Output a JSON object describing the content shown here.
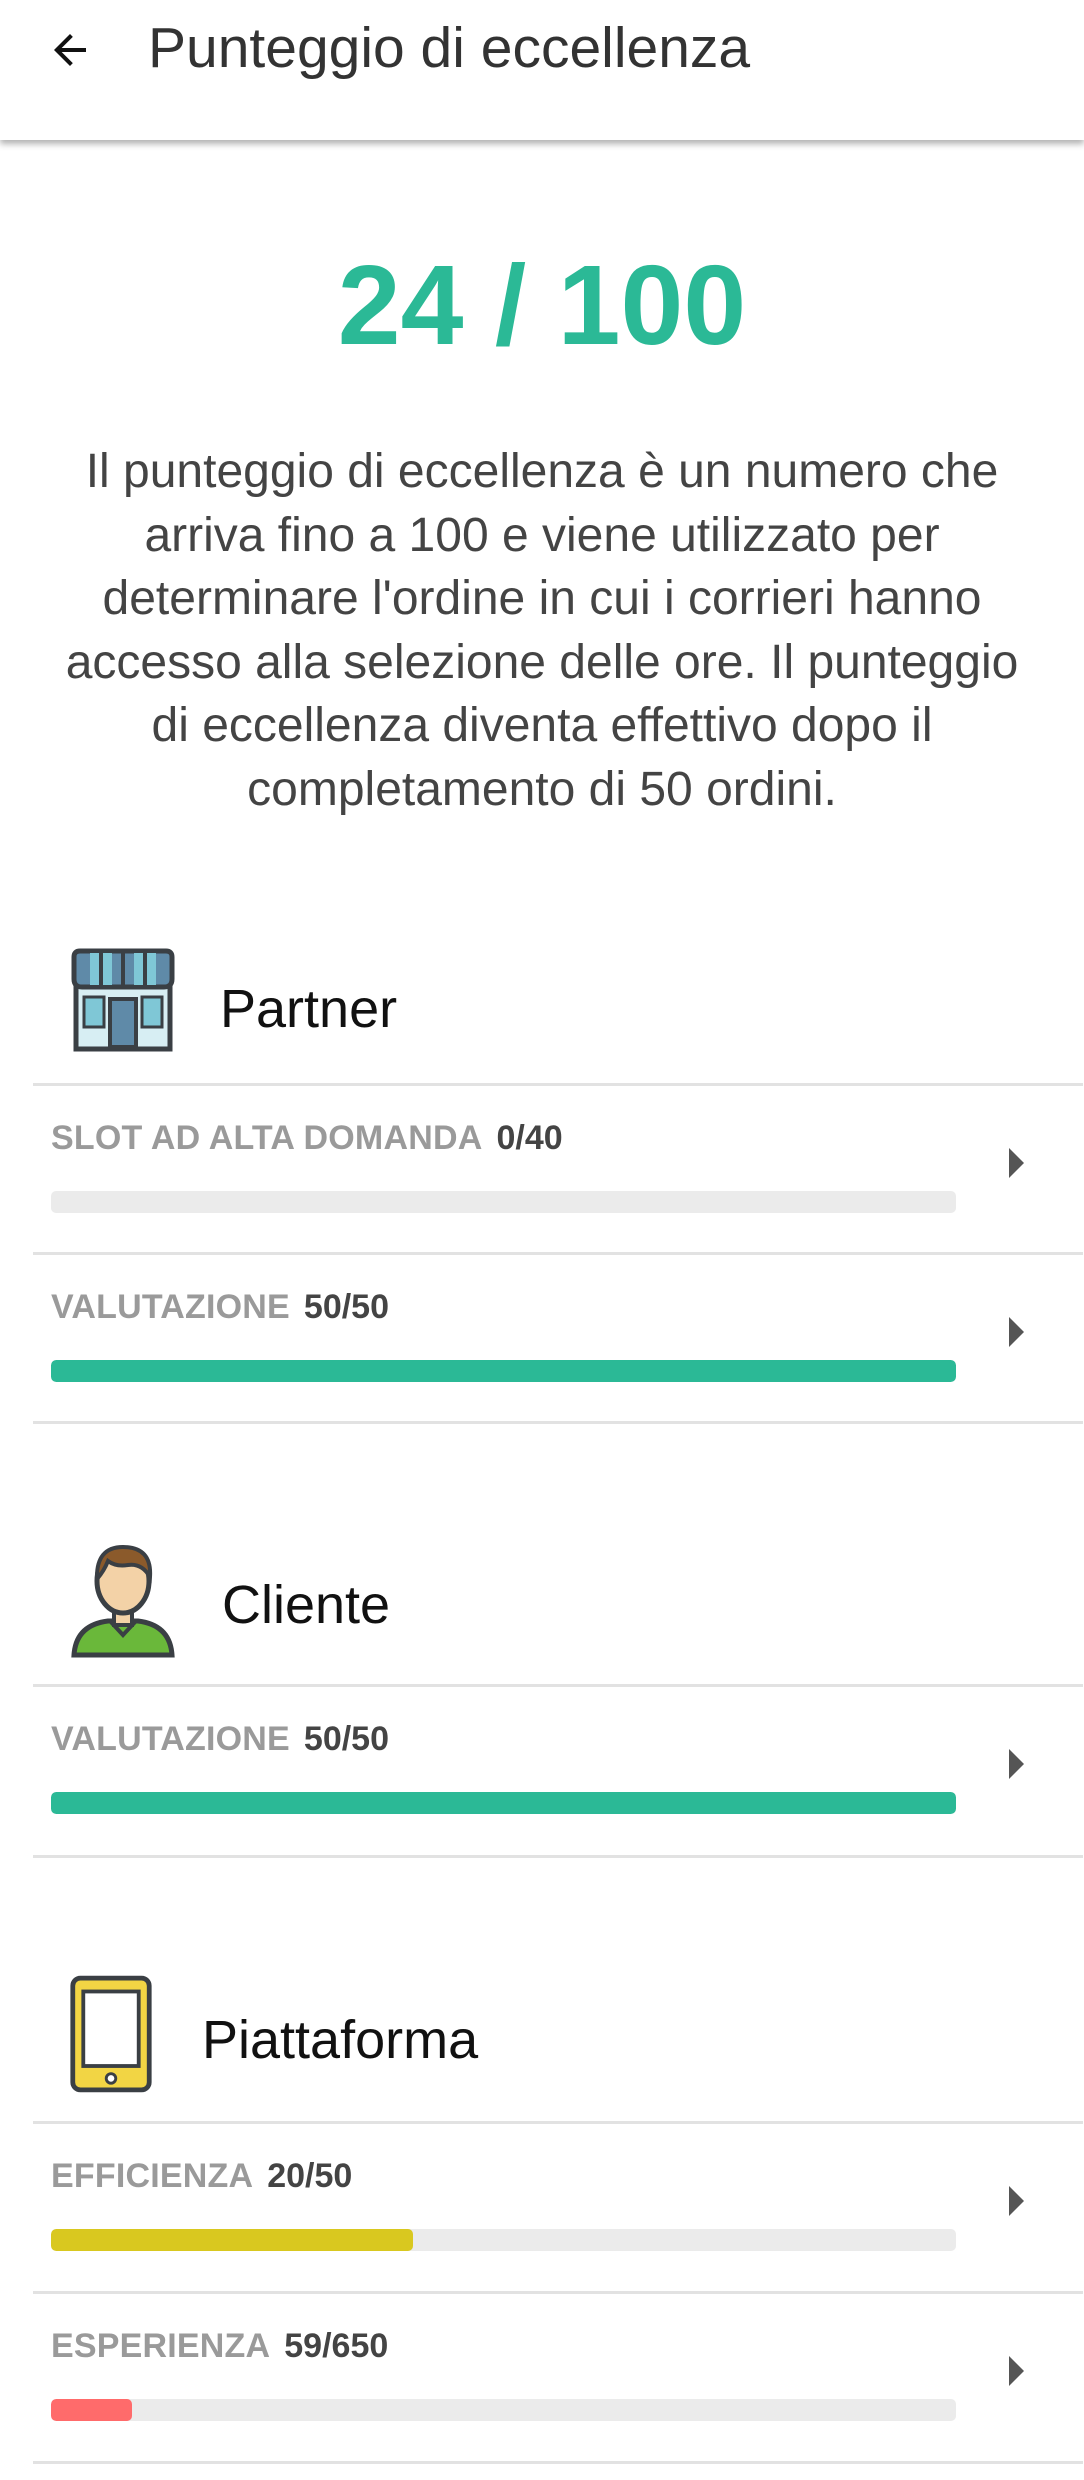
{
  "appbar": {
    "title": "Punteggio di eccellenza",
    "back_icon": "arrow-left-icon"
  },
  "score": {
    "text": "24 / 100",
    "color": "#2bb996"
  },
  "description": "Il punteggio di eccellenza è un numero che arriva fino a 100 e viene utilizzato per determinare l'ordine in cui i corrieri hanno accesso alla selezione delle ore. Il punteggio di eccellenza diventa effettivo dopo il completamento di 50 ordini.",
  "sections": {
    "partner": {
      "title": "Partner",
      "icon": "storefront-icon",
      "metrics": [
        {
          "name": "SLOT AD ALTA DOMANDA",
          "value": "0/40",
          "progress": 0.0,
          "color": "#2bb996"
        },
        {
          "name": "VALUTAZIONE",
          "value": "50/50",
          "progress": 1.0,
          "color": "#2bb996"
        }
      ]
    },
    "cliente": {
      "title": "Cliente",
      "icon": "customer-avatar-icon",
      "metrics": [
        {
          "name": "VALUTAZIONE",
          "value": "50/50",
          "progress": 1.0,
          "color": "#2bb996"
        }
      ]
    },
    "piattaforma": {
      "title": "Piattaforma",
      "icon": "smartphone-icon",
      "metrics": [
        {
          "name": "EFFICIENZA",
          "value": "20/50",
          "progress": 0.4,
          "color": "#d9c81f"
        },
        {
          "name": "ESPERIENZA",
          "value": "59/650",
          "progress": 0.09,
          "color": "#ff6b6b"
        }
      ]
    }
  }
}
